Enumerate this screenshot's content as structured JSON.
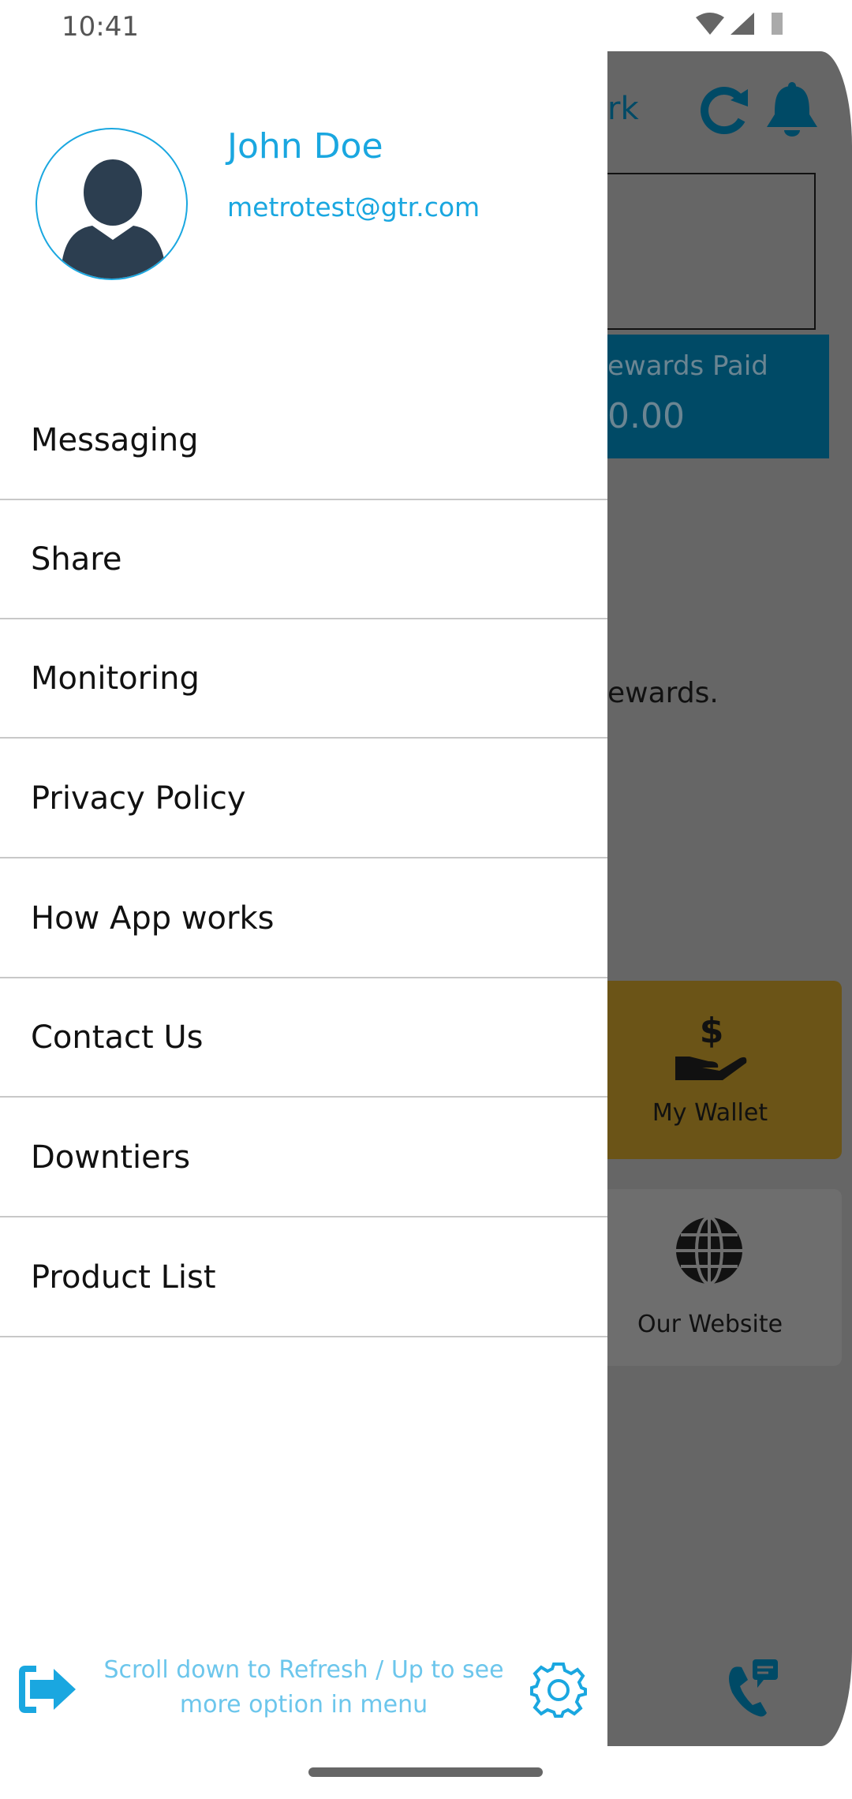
{
  "status_bar": {
    "time": "10:41",
    "icons": [
      "wifi-icon",
      "signal-icon",
      "battery-icon"
    ]
  },
  "background": {
    "title_fragment": "rk",
    "rewards_label_fragment": "ewards Paid",
    "rewards_value_fragment": "0.00",
    "text_fragment": "ewards.",
    "wallet_label": "My Wallet",
    "website_label": "Our Website",
    "colors": {
      "primary": "#004a66",
      "wallet_card": "#6b5417",
      "overlay": "#666666"
    }
  },
  "drawer": {
    "user": {
      "name": "John Doe",
      "email": "metrotest@gtr.com"
    },
    "items": [
      {
        "label": "Messaging"
      },
      {
        "label": "Share"
      },
      {
        "label": "Monitoring"
      },
      {
        "label": "Privacy Policy"
      },
      {
        "label": "How App works"
      },
      {
        "label": "Contact Us"
      },
      {
        "label": "Downtiers"
      },
      {
        "label": "Product List"
      }
    ],
    "footer": {
      "hint_line1": "Scroll down to Refresh / Up to see",
      "hint_line2": "more option in menu"
    },
    "colors": {
      "accent": "#1aa7e0",
      "hint": "#6cc6ec"
    }
  }
}
